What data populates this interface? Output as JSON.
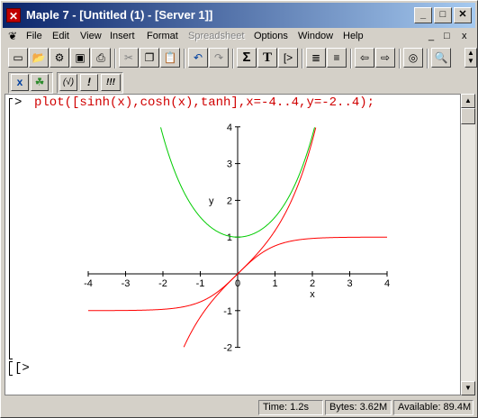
{
  "window": {
    "title": "Maple 7  - [Untitled (1) - [Server 1]]",
    "app_icon": "maple-x-icon",
    "controls": [
      "minimize",
      "maximize",
      "close"
    ]
  },
  "menubar": {
    "items": [
      {
        "label": "File",
        "enabled": true
      },
      {
        "label": "Edit",
        "enabled": true
      },
      {
        "label": "View",
        "enabled": true
      },
      {
        "label": "Insert",
        "enabled": true
      },
      {
        "label": "Format",
        "enabled": true
      },
      {
        "label": "Spreadsheet",
        "enabled": false
      },
      {
        "label": "Options",
        "enabled": true
      },
      {
        "label": "Window",
        "enabled": true
      },
      {
        "label": "Help",
        "enabled": true
      }
    ],
    "doc_controls": [
      "_",
      "□",
      "x"
    ]
  },
  "toolbar": {
    "icons": [
      "new-icon",
      "open-icon",
      "open-url-icon",
      "save-icon",
      "print-icon",
      "cut-icon",
      "copy-icon",
      "paste-icon",
      "undo-icon",
      "redo-icon",
      "sigma-icon",
      "text-T-icon",
      "insert-input-icon",
      "indent-icon",
      "outdent-icon",
      "back-icon",
      "forward-icon",
      "stop-icon",
      "zoom-icon"
    ],
    "labels": {
      "sigma": "Σ",
      "text": "T",
      "input": "[>"
    }
  },
  "context_toolbar": {
    "buttons": [
      "x",
      "☘",
      "(√)",
      "!",
      "!!!"
    ]
  },
  "worksheet": {
    "prompt": ">",
    "command": "plot([sinh(x),cosh(x),tanh],x=-4..4,y=-2..4);",
    "empty_prompt": "[>"
  },
  "chart_data": {
    "type": "line",
    "xlabel": "x",
    "ylabel": "y",
    "xlim": [
      -4,
      4
    ],
    "ylim": [
      -2,
      4
    ],
    "x_ticks": [
      "-4",
      "-3",
      "-2",
      "-1",
      "0",
      "1",
      "2",
      "3",
      "4"
    ],
    "y_ticks": [
      "-2",
      "-1",
      "1",
      "2",
      "3",
      "4"
    ],
    "series": [
      {
        "function": "sinh",
        "color": "#ff0000"
      },
      {
        "function": "cosh",
        "color": "#00cc00"
      },
      {
        "function": "tanh",
        "color": "#ff0000"
      }
    ]
  },
  "statusbar": {
    "time": "Time:  1.2s",
    "bytes": "Bytes: 3.62M",
    "available": "Available: 89.4M"
  }
}
